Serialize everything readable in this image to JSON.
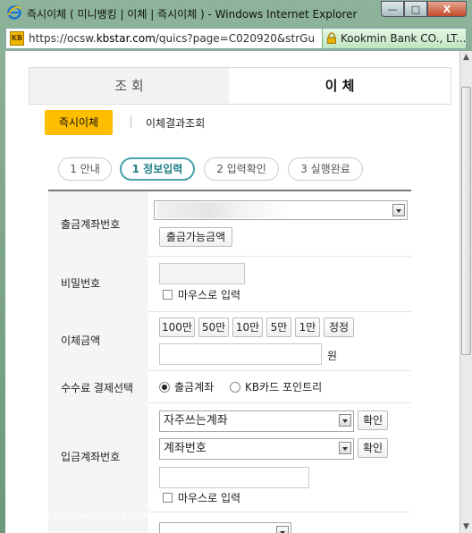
{
  "window": {
    "title": "즉시이체 ( 미니뱅킹 | 이체 | 즉시이체 ) - Windows Internet Explorer",
    "minimize_label": "—",
    "maximize_label": "□",
    "close_label": "X"
  },
  "address_bar": {
    "url_prefix": "https://ocsw.",
    "url_domain": "kbstar.com",
    "url_rest": "/quics?page=C020920&strGuidVi",
    "certificate": "Kookmin Bank CO., LT...",
    "favicon_text": "KB"
  },
  "tabs": [
    "조 회",
    "이 체"
  ],
  "subtabs": [
    "즉시이체",
    "이체결과조회"
  ],
  "steps": [
    "1 안내",
    "1 정보입력",
    "2 입력확인",
    "3 실행완료"
  ],
  "form": {
    "withdraw_account_label": "출금계좌번호",
    "available_amount_button": "출금가능금액",
    "password_label": "비밀번호",
    "mouse_input_label": "마우스로 입력",
    "amount_label": "이체금액",
    "amount_buttons": [
      "100만",
      "50만",
      "10만",
      "5만",
      "1만",
      "정정"
    ],
    "won_unit": "원",
    "fee_label": "수수료 결제선택",
    "fee_options": [
      "출금계좌",
      "KB카드 포인트리"
    ],
    "deposit_account_label": "입금계좌번호",
    "frequent_account_select": "자주쓰는계좌",
    "account_number_select": "계좌번호",
    "confirm_button": "확인"
  },
  "watermark": "http://dreamdrive.tistory.com",
  "colors": {
    "accent": "#ffbd00",
    "step_active": "#49a3a9"
  }
}
